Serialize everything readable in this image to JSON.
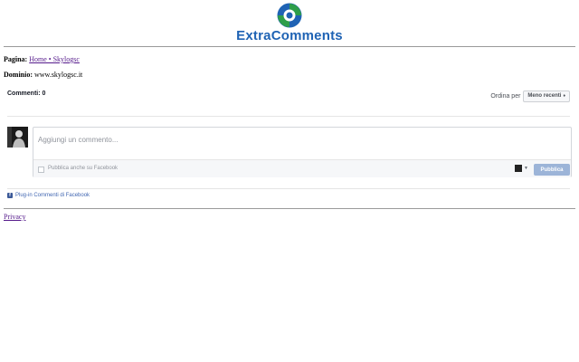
{
  "header": {
    "logo_text": "ExtraComments",
    "colors": {
      "brand_blue": "#1f63b4",
      "brand_green": "#2e9e4a"
    }
  },
  "info": {
    "page_label": "Pagina:",
    "page_link": "Home • Skylogsc",
    "domain_label": "Dominio:",
    "domain_value": "www.skylogsc.it"
  },
  "fb_plugin": {
    "comment_count": "Commenti: 0",
    "sort_label": "Ordina per",
    "sort_selected": "Meno recenti",
    "input_placeholder": "Aggiungi un commento...",
    "share_checkbox_label": "Pubblica anche su Facebook",
    "publish_button": "Pubblica",
    "plugin_link": "Plug-in Commenti di Facebook",
    "icons": {
      "avatar": "user-avatar",
      "identity": "identity-selector-icon",
      "facebook": "facebook-icon"
    },
    "colors": {
      "link": "#4267b2",
      "publish_disabled": "#9cb4d8",
      "footer_bg": "#f6f7f9"
    }
  },
  "footer": {
    "privacy_link": "Privacy"
  }
}
